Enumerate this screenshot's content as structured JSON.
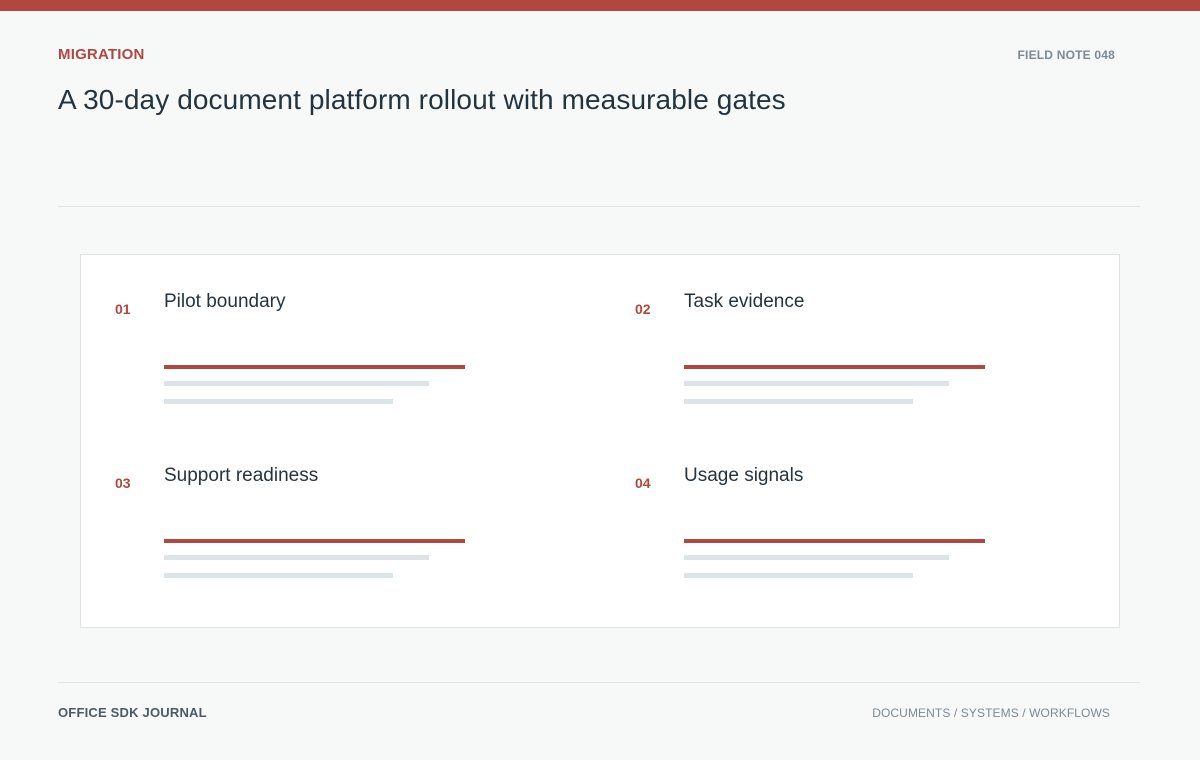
{
  "header": {
    "kicker": "MIGRATION",
    "note_id": "FIELD NOTE 048",
    "title": "A 30-day document platform rollout with measurable gates"
  },
  "items": [
    {
      "number": "01",
      "label": "Pilot boundary"
    },
    {
      "number": "02",
      "label": "Task evidence"
    },
    {
      "number": "03",
      "label": "Support readiness"
    },
    {
      "number": "04",
      "label": "Usage signals"
    }
  ],
  "footer": {
    "publication": "OFFICE SDK JOURNAL",
    "sections": "DOCUMENTS / SYSTEMS / WORKFLOWS"
  },
  "colors": {
    "accent": "#b0483f",
    "text": "#24343f",
    "muted": "#7d8a93",
    "placeholder": "#dde4e8",
    "background": "#f7f9f9"
  }
}
